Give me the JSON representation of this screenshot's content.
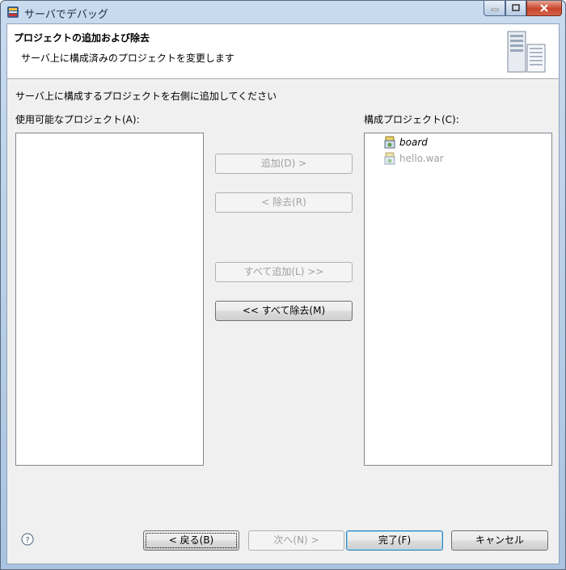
{
  "window": {
    "title": "サーバでデバッグ"
  },
  "header": {
    "title": "プロジェクトの追加および除去",
    "description": "サーバ上に構成済みのプロジェクトを変更します"
  },
  "instruction": "サーバ上に構成するプロジェクトを右側に追加してください",
  "available": {
    "label": "使用可能なプロジェクト(A):",
    "items": []
  },
  "configured": {
    "label": "構成プロジェクト(C):",
    "items": [
      {
        "name": "board",
        "enabled": true
      },
      {
        "name": "hello.war",
        "enabled": false
      }
    ]
  },
  "move_buttons": {
    "add": "追加(D) >",
    "remove": "< 除去(R)",
    "add_all": "すべて追加(L) >>",
    "remove_all": "<< すべて除去(M)"
  },
  "footer": {
    "back": "< 戻る(B)",
    "next": "次へ(N) >",
    "finish": "完了(F)",
    "cancel": "キャンセル"
  }
}
